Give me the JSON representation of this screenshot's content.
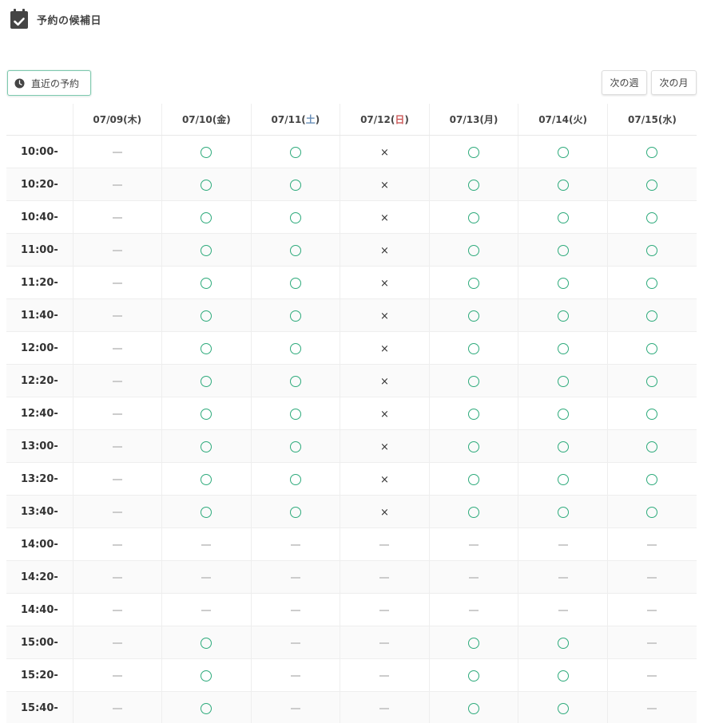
{
  "header": {
    "title": "予約の候補日",
    "icon": "calendar-check-icon"
  },
  "toolbar": {
    "recent_label": "直近の予約",
    "recent_icon": "clock-icon",
    "next_week_label": "次の週",
    "next_month_label": "次の月"
  },
  "colors": {
    "available": "#2daa7b",
    "saturday": "#6a8fb8",
    "sunday": "#cc5a5a",
    "unavailable_dash": "#cccccc"
  },
  "days": [
    {
      "date": "07/09",
      "dow": "木",
      "type": "weekday"
    },
    {
      "date": "07/10",
      "dow": "金",
      "type": "weekday"
    },
    {
      "date": "07/11",
      "dow": "土",
      "type": "sat"
    },
    {
      "date": "07/12",
      "dow": "日",
      "type": "sun"
    },
    {
      "date": "07/13",
      "dow": "月",
      "type": "weekday"
    },
    {
      "date": "07/14",
      "dow": "火",
      "type": "weekday"
    },
    {
      "date": "07/15",
      "dow": "水",
      "type": "weekday"
    }
  ],
  "legend_marks": {
    "available": "○",
    "full": "×",
    "not_applicable": "—"
  },
  "slots": [
    {
      "time": "10:00-",
      "status": [
        "-",
        "o",
        "o",
        "x",
        "o",
        "o",
        "o"
      ]
    },
    {
      "time": "10:20-",
      "status": [
        "-",
        "o",
        "o",
        "x",
        "o",
        "o",
        "o"
      ]
    },
    {
      "time": "10:40-",
      "status": [
        "-",
        "o",
        "o",
        "x",
        "o",
        "o",
        "o"
      ]
    },
    {
      "time": "11:00-",
      "status": [
        "-",
        "o",
        "o",
        "x",
        "o",
        "o",
        "o"
      ]
    },
    {
      "time": "11:20-",
      "status": [
        "-",
        "o",
        "o",
        "x",
        "o",
        "o",
        "o"
      ]
    },
    {
      "time": "11:40-",
      "status": [
        "-",
        "o",
        "o",
        "x",
        "o",
        "o",
        "o"
      ]
    },
    {
      "time": "12:00-",
      "status": [
        "-",
        "o",
        "o",
        "x",
        "o",
        "o",
        "o"
      ]
    },
    {
      "time": "12:20-",
      "status": [
        "-",
        "o",
        "o",
        "x",
        "o",
        "o",
        "o"
      ]
    },
    {
      "time": "12:40-",
      "status": [
        "-",
        "o",
        "o",
        "x",
        "o",
        "o",
        "o"
      ]
    },
    {
      "time": "13:00-",
      "status": [
        "-",
        "o",
        "o",
        "x",
        "o",
        "o",
        "o"
      ]
    },
    {
      "time": "13:20-",
      "status": [
        "-",
        "o",
        "o",
        "x",
        "o",
        "o",
        "o"
      ]
    },
    {
      "time": "13:40-",
      "status": [
        "-",
        "o",
        "o",
        "x",
        "o",
        "o",
        "o"
      ]
    },
    {
      "time": "14:00-",
      "status": [
        "-",
        "-",
        "-",
        "-",
        "-",
        "-",
        "-"
      ]
    },
    {
      "time": "14:20-",
      "status": [
        "-",
        "-",
        "-",
        "-",
        "-",
        "-",
        "-"
      ]
    },
    {
      "time": "14:40-",
      "status": [
        "-",
        "-",
        "-",
        "-",
        "-",
        "-",
        "-"
      ]
    },
    {
      "time": "15:00-",
      "status": [
        "-",
        "o",
        "-",
        "-",
        "o",
        "o",
        "-"
      ]
    },
    {
      "time": "15:20-",
      "status": [
        "-",
        "o",
        "-",
        "-",
        "o",
        "o",
        "-"
      ]
    },
    {
      "time": "15:40-",
      "status": [
        "-",
        "o",
        "-",
        "-",
        "o",
        "o",
        "-"
      ]
    }
  ]
}
